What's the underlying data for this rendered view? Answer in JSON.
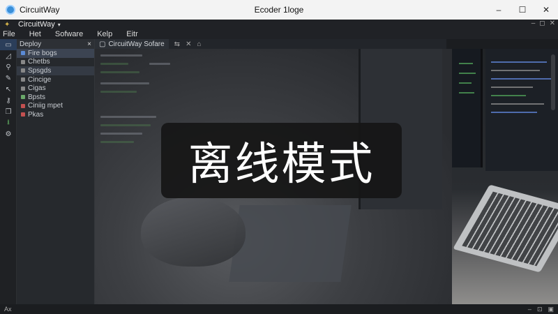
{
  "app": {
    "name": "CircuitWay",
    "window_title": "Ecoder 1loge"
  },
  "window_controls": [
    "–",
    "☐",
    "✕"
  ],
  "inner_window": {
    "title": "CircuitWay",
    "controls": [
      "–",
      "◻",
      "✕"
    ]
  },
  "menu": [
    "File",
    "Het",
    "Sofware",
    "Kelp",
    "Eitr"
  ],
  "rail_icons": [
    "panel-icon",
    "edit-icon",
    "pin-icon",
    "pencil-icon",
    "cursor-icon",
    "probe-icon",
    "layers-icon",
    "download-icon",
    "gear-icon"
  ],
  "panel": {
    "title": "Deploy",
    "close": "×",
    "items": [
      {
        "label": "Fire bogs",
        "color": "#5b8bd6"
      },
      {
        "label": "Chetbs",
        "color": "#888888"
      },
      {
        "label": "Spsgds",
        "color": "#888888"
      },
      {
        "label": "Cincige",
        "color": "#888888"
      },
      {
        "label": "Cigas",
        "color": "#888888"
      },
      {
        "label": "Bpsts",
        "color": "#6aa86a"
      },
      {
        "label": "Ciniig mpet",
        "color": "#c25050"
      },
      {
        "label": "Pkas",
        "color": "#c25050"
      }
    ]
  },
  "editor": {
    "tab_label": "CircuitWay Sofare",
    "tab_controls": [
      "⇆",
      "✕",
      "⌂"
    ]
  },
  "overlay": {
    "text": "离线模式"
  },
  "status": {
    "left": "Ax",
    "right": [
      "–",
      "⊡",
      "▣"
    ]
  }
}
